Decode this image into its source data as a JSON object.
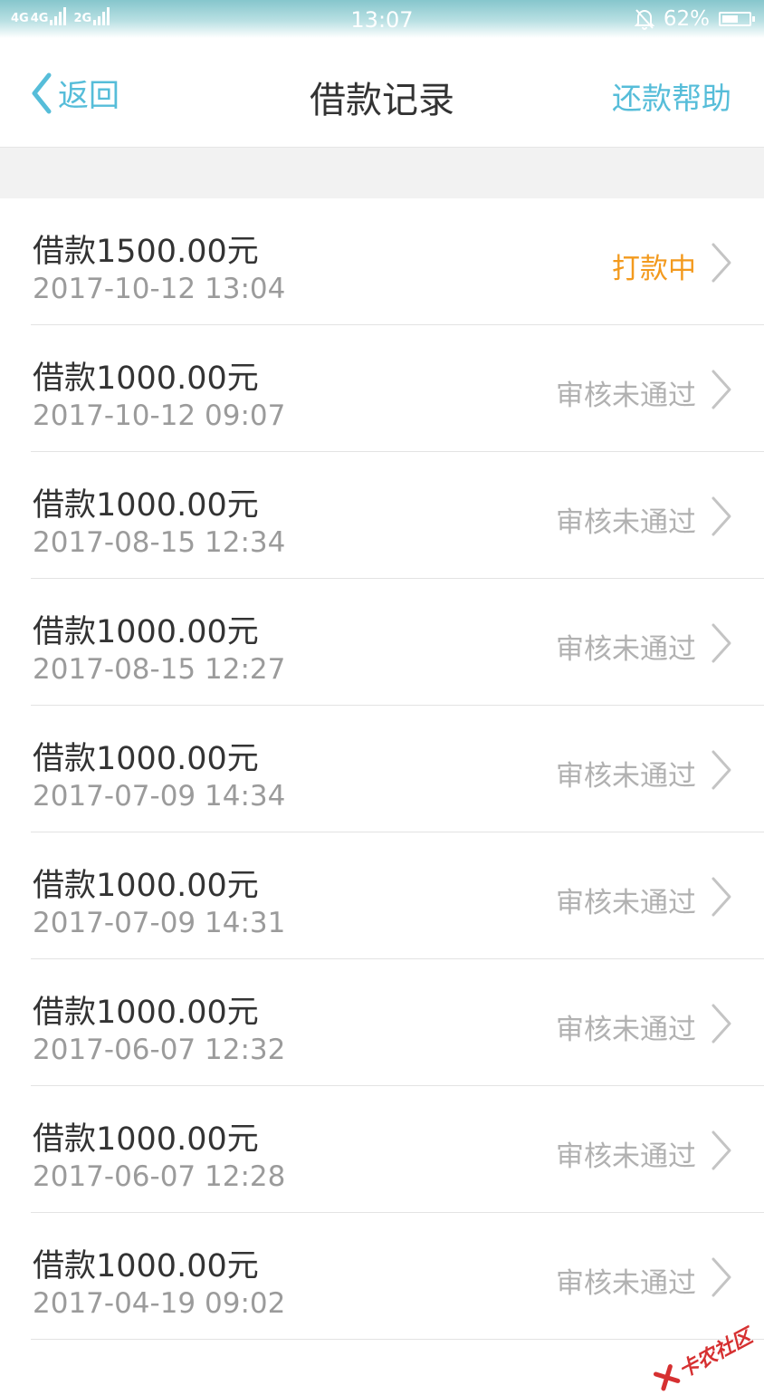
{
  "status_bar": {
    "network_1": "4G",
    "network_2": "4G",
    "network_3": "2G",
    "time": "13:07",
    "battery": "62%",
    "battery_level": 0.62
  },
  "nav": {
    "back_label": "返回",
    "title": "借款记录",
    "help_label": "还款帮助"
  },
  "colors": {
    "accent": "#56bdd9",
    "pending": "#f39a1e",
    "status_gray": "#b1b1b1"
  },
  "records": [
    {
      "amount": "借款1500.00元",
      "time": "2017-10-12 13:04",
      "status": "打款中",
      "kind": "pending"
    },
    {
      "amount": "借款1000.00元",
      "time": "2017-10-12 09:07",
      "status": "审核未通过",
      "kind": "rejected"
    },
    {
      "amount": "借款1000.00元",
      "time": "2017-08-15 12:34",
      "status": "审核未通过",
      "kind": "rejected"
    },
    {
      "amount": "借款1000.00元",
      "time": "2017-08-15 12:27",
      "status": "审核未通过",
      "kind": "rejected"
    },
    {
      "amount": "借款1000.00元",
      "time": "2017-07-09 14:34",
      "status": "审核未通过",
      "kind": "rejected"
    },
    {
      "amount": "借款1000.00元",
      "time": "2017-07-09 14:31",
      "status": "审核未通过",
      "kind": "rejected"
    },
    {
      "amount": "借款1000.00元",
      "time": "2017-06-07 12:32",
      "status": "审核未通过",
      "kind": "rejected"
    },
    {
      "amount": "借款1000.00元",
      "time": "2017-06-07 12:28",
      "status": "审核未通过",
      "kind": "rejected"
    },
    {
      "amount": "借款1000.00元",
      "time": "2017-04-19 09:02",
      "status": "审核未通过",
      "kind": "rejected"
    }
  ],
  "watermark": {
    "text": "卡农社区",
    "icon": "kanong-logo-icon"
  }
}
